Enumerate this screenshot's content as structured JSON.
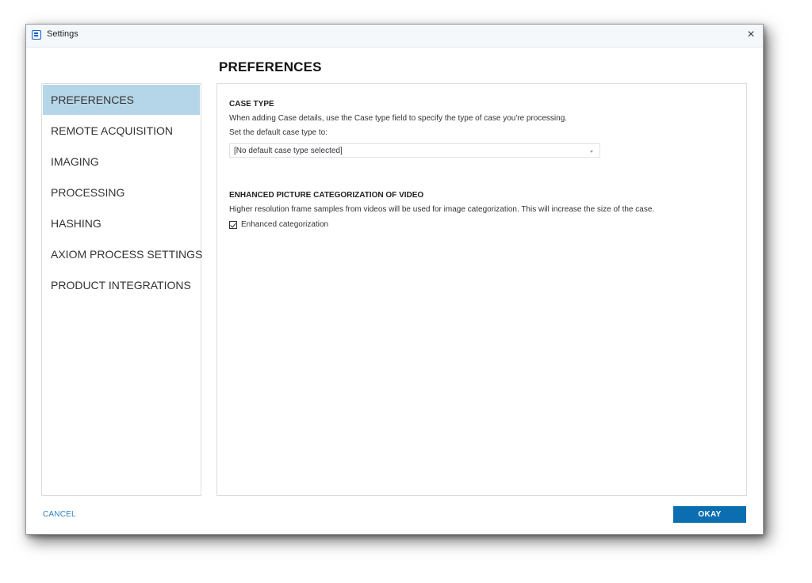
{
  "window": {
    "title": "Settings",
    "icon": "app-window-icon",
    "close_icon": "×"
  },
  "page": {
    "title": "PREFERENCES"
  },
  "sidebar": {
    "items": [
      {
        "label": "PREFERENCES",
        "active": true
      },
      {
        "label": "REMOTE ACQUISITION",
        "active": false
      },
      {
        "label": "IMAGING",
        "active": false
      },
      {
        "label": "PROCESSING",
        "active": false
      },
      {
        "label": "HASHING",
        "active": false
      },
      {
        "label": "AXIOM PROCESS SETTINGS",
        "active": false
      },
      {
        "label": "PRODUCT INTEGRATIONS",
        "active": false
      }
    ]
  },
  "case_type": {
    "heading": "CASE TYPE",
    "description": "When adding Case details, use the Case type field to specify the type of case you're processing.",
    "default_label": "Set the default case type to:",
    "selected_value": "[No default case type selected]"
  },
  "enhanced": {
    "heading": "ENHANCED PICTURE CATEGORIZATION OF VIDEO",
    "description": "Higher resolution frame samples from videos will be used for image categorization. This will increase the size of the case.",
    "checkbox_label": "Enhanced categorization",
    "checked": true
  },
  "footer": {
    "cancel_label": "CANCEL",
    "okay_label": "OKAY"
  },
  "colors": {
    "accent": "#0b6eb0",
    "active_nav": "#b5d5e8",
    "link": "#2f7fc0"
  }
}
